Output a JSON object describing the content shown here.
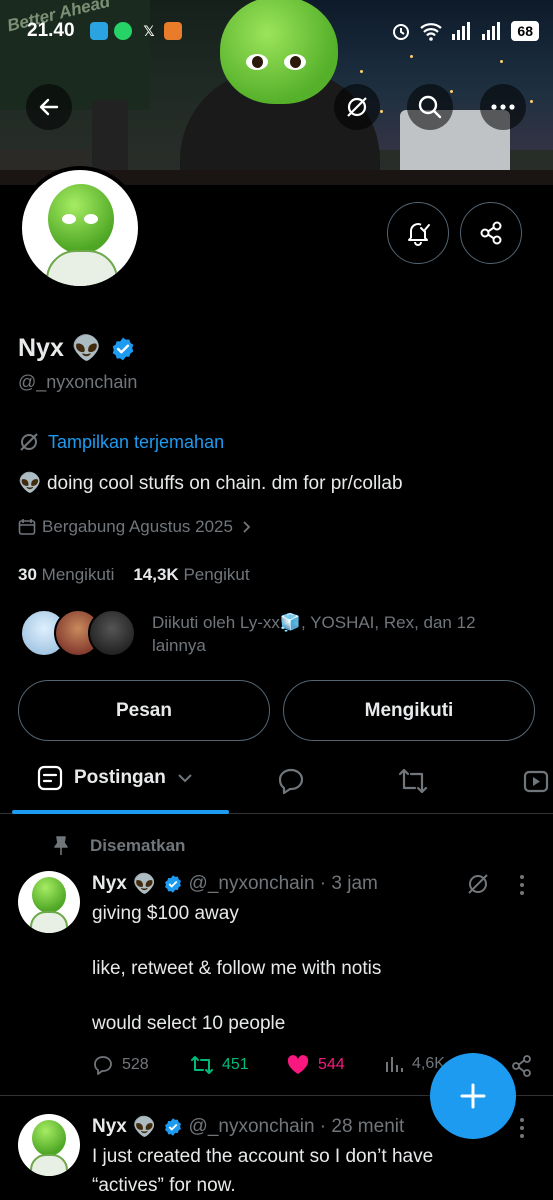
{
  "status_bar": {
    "time": "21.40",
    "battery": "68"
  },
  "banner": {
    "poster_text": "Better Ahead"
  },
  "profile": {
    "name": "Nyx",
    "handle": "@_nyxonchain",
    "translate": "Tampilkan terjemahan",
    "bio": "doing cool stuffs on chain. dm for pr/collab",
    "joined": "Bergabung Agustus 2025",
    "following_count": "30",
    "following_label": "Mengikuti",
    "followers_count": "14,3K",
    "followers_label": "Pengikut",
    "followed_by": "Diikuti oleh Ly-xx🧊, YOSHAI, Rex, dan 12 lainnya"
  },
  "buttons": {
    "message": "Pesan",
    "following": "Mengikuti"
  },
  "tabs": {
    "active": "Postingan"
  },
  "pinned_label": "Disematkan",
  "tweets": [
    {
      "name": "Nyx",
      "meta": "@_nyxonchain · 3 jam",
      "lines": [
        "giving $100 away",
        "like, retweet & follow me  with notis",
        "would select 10 people"
      ],
      "replies": "528",
      "retweets": "451",
      "likes": "544",
      "views": "4,6K"
    },
    {
      "name": "Nyx",
      "meta": "@_nyxonchain · 28 menit",
      "lines": [
        "I just created the account so I don’t have",
        "“actives” for now."
      ]
    }
  ],
  "colors": {
    "accent": "#1d9bf0",
    "retweet": "#00ba7c",
    "like": "#f91880",
    "muted": "#71767b"
  }
}
